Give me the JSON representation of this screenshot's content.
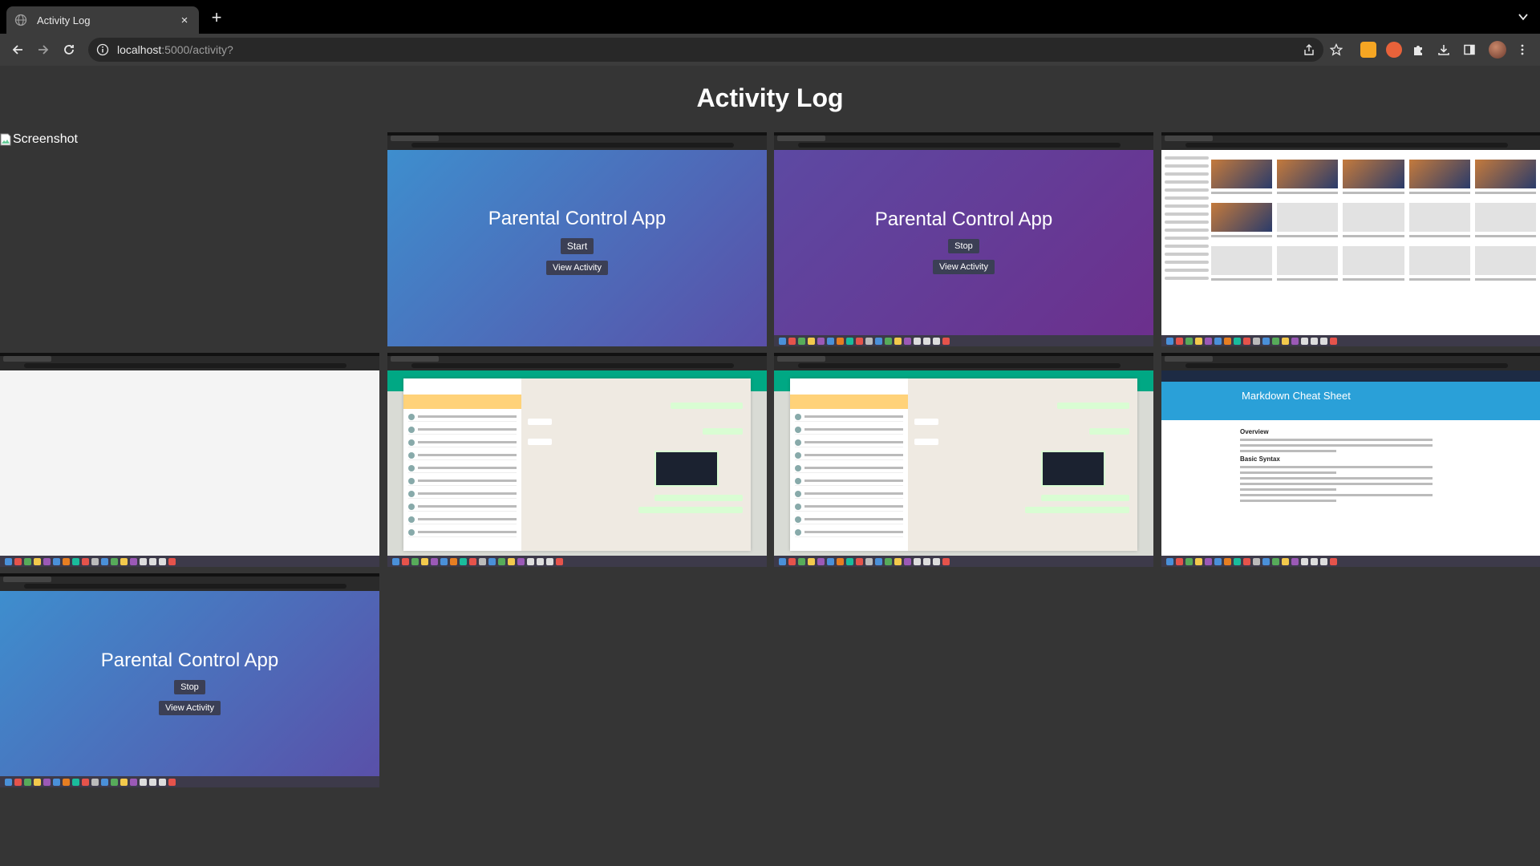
{
  "browser": {
    "tab_title": "Activity Log",
    "url_host": "localhost",
    "url_rest": ":5000/activity?",
    "new_tab_symbol": "+",
    "close_symbol": "×"
  },
  "page": {
    "title": "Activity Log",
    "broken_image_alt": "Screenshot"
  },
  "screenshots": [
    {
      "id": "pc1",
      "app_title": "Parental Control App",
      "primary_button": "Start",
      "secondary_button": "View Activity"
    },
    {
      "id": "pc2",
      "app_title": "Parental Control App",
      "primary_button": "Stop",
      "secondary_button": "View Activity"
    },
    {
      "id": "pc3",
      "app_title": "Parental Control App",
      "primary_button": "Stop",
      "secondary_button": "View Activity"
    },
    {
      "id": "md",
      "hero_title": "Markdown Cheat Sheet",
      "overview": "Overview",
      "basic_syntax": "Basic Syntax"
    }
  ],
  "icons": {
    "globe": "globe-icon",
    "back": "back-arrow-icon",
    "forward": "forward-arrow-icon",
    "reload": "reload-icon",
    "info": "info-icon",
    "share": "share-icon",
    "bookmark": "star-icon",
    "extensions": "puzzle-icon",
    "download": "download-icon",
    "sidepanel": "sidepanel-icon",
    "menu": "kebab-menu-icon"
  },
  "colors": {
    "page_bg": "#353535",
    "chrome_bg": "#3c3c3c",
    "tabstrip_bg": "#000000"
  }
}
